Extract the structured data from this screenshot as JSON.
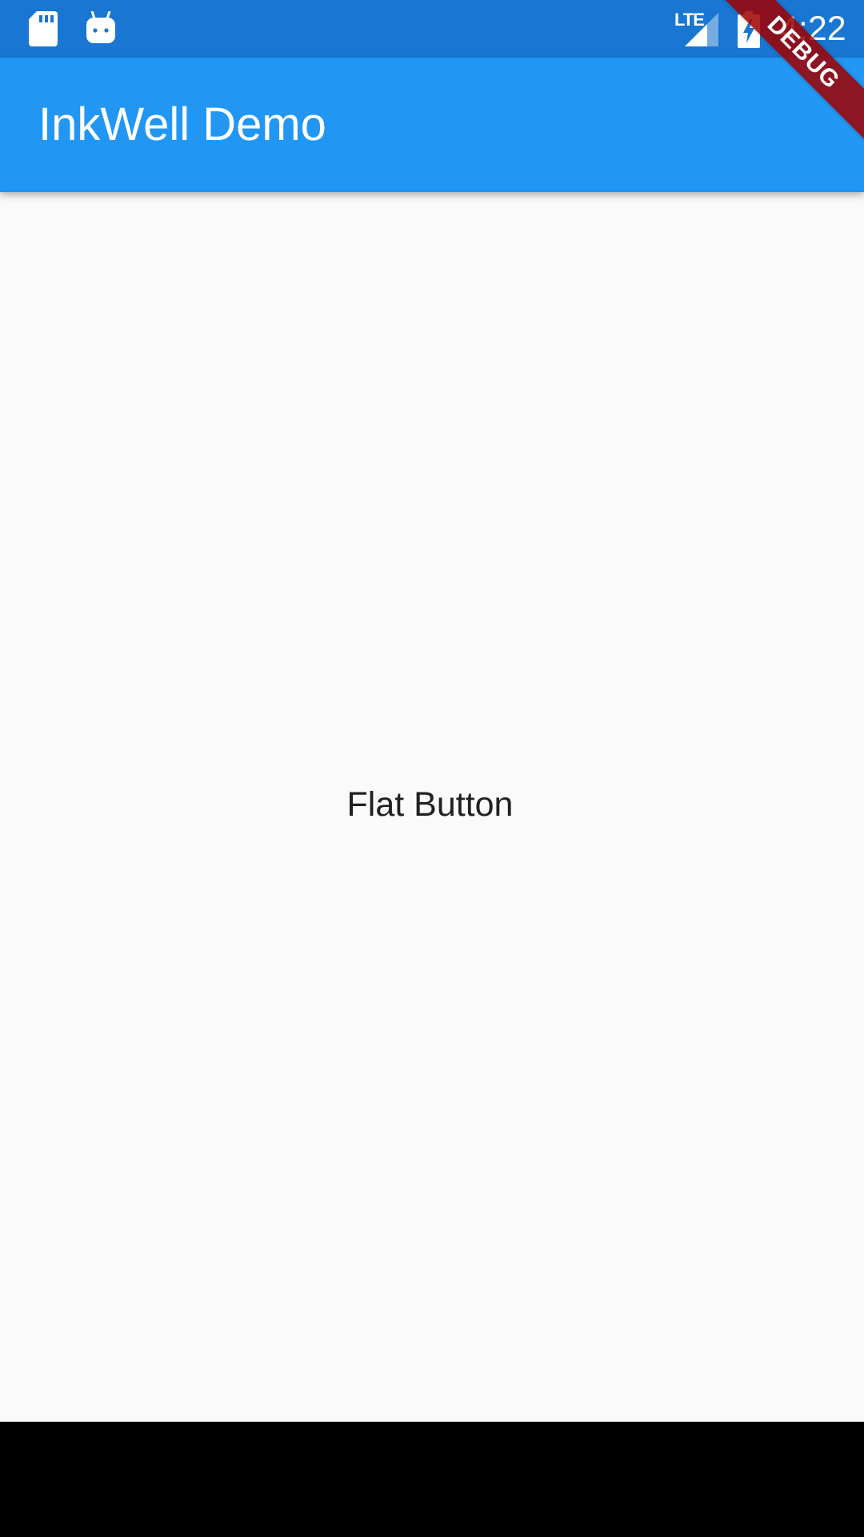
{
  "status_bar": {
    "network": "LTE",
    "time": "4:22",
    "icons": [
      "sd-card-icon",
      "android-debug-icon",
      "lte-signal-icon",
      "battery-charging-icon"
    ]
  },
  "app_bar": {
    "title": "InkWell Demo"
  },
  "main": {
    "button_label": "Flat Button"
  },
  "debug_banner": {
    "label": "DEBUG"
  },
  "colors": {
    "status_bar": "#1976d2",
    "app_bar": "#2196f3",
    "background": "#fafafa",
    "nav_bar": "#000000",
    "debug_banner": "#a00000"
  }
}
